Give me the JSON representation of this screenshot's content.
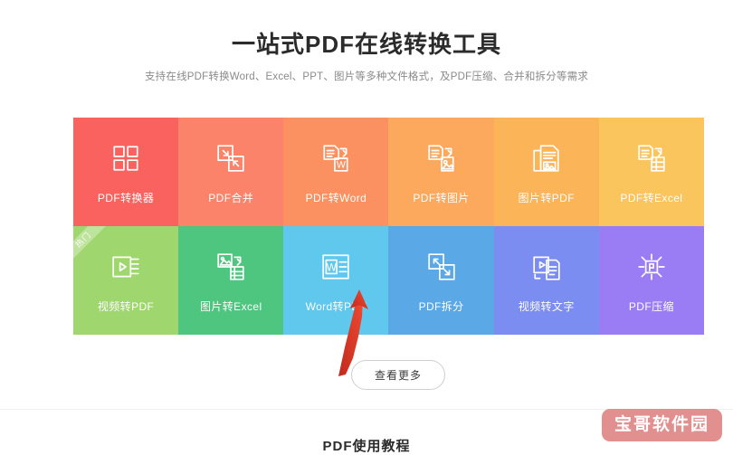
{
  "header": {
    "title": "一站式PDF在线转换工具",
    "subtitle": "支持在线PDF转换Word、Excel、PPT、图片等多种文件格式，及PDF压缩、合并和拆分等需求"
  },
  "tiles": [
    {
      "label": "PDF转换器",
      "icon": "grid-four-squares-icon",
      "color": "#F9625F",
      "badge": ""
    },
    {
      "label": "PDF合并",
      "icon": "merge-documents-icon",
      "color": "#FB8369",
      "badge": ""
    },
    {
      "label": "PDF转Word",
      "icon": "pdf-to-word-icon",
      "color": "#FB9060",
      "badge": ""
    },
    {
      "label": "PDF转图片",
      "icon": "pdf-to-image-icon",
      "color": "#FCA95E",
      "badge": ""
    },
    {
      "label": "图片转PDF",
      "icon": "image-to-pdf-icon",
      "color": "#FBB457",
      "badge": ""
    },
    {
      "label": "PDF转Excel",
      "icon": "pdf-to-excel-icon",
      "color": "#F9C55C",
      "badge": ""
    },
    {
      "label": "视频转PDF",
      "icon": "video-to-pdf-icon",
      "color": "#9FD66E",
      "badge": "热门"
    },
    {
      "label": "图片转Excel",
      "icon": "image-to-excel-icon",
      "color": "#4FC67F",
      "badge": ""
    },
    {
      "label": "Word转PDF",
      "icon": "word-to-pdf-icon",
      "color": "#5FC8EC",
      "badge": ""
    },
    {
      "label": "PDF拆分",
      "icon": "split-documents-icon",
      "color": "#5AA9E6",
      "badge": ""
    },
    {
      "label": "视频转文字",
      "icon": "video-to-text-icon",
      "color": "#7B8DF0",
      "badge": ""
    },
    {
      "label": "PDF压缩",
      "icon": "compress-pdf-icon",
      "color": "#9A7CF4",
      "badge": ""
    }
  ],
  "more_button": {
    "label": "查看更多"
  },
  "annotation": {
    "arrow_color": "#E03A28"
  },
  "bottom": {
    "section_title": "PDF使用教程"
  },
  "watermark": {
    "text": "宝哥软件园",
    "color": "#e08a8a"
  }
}
